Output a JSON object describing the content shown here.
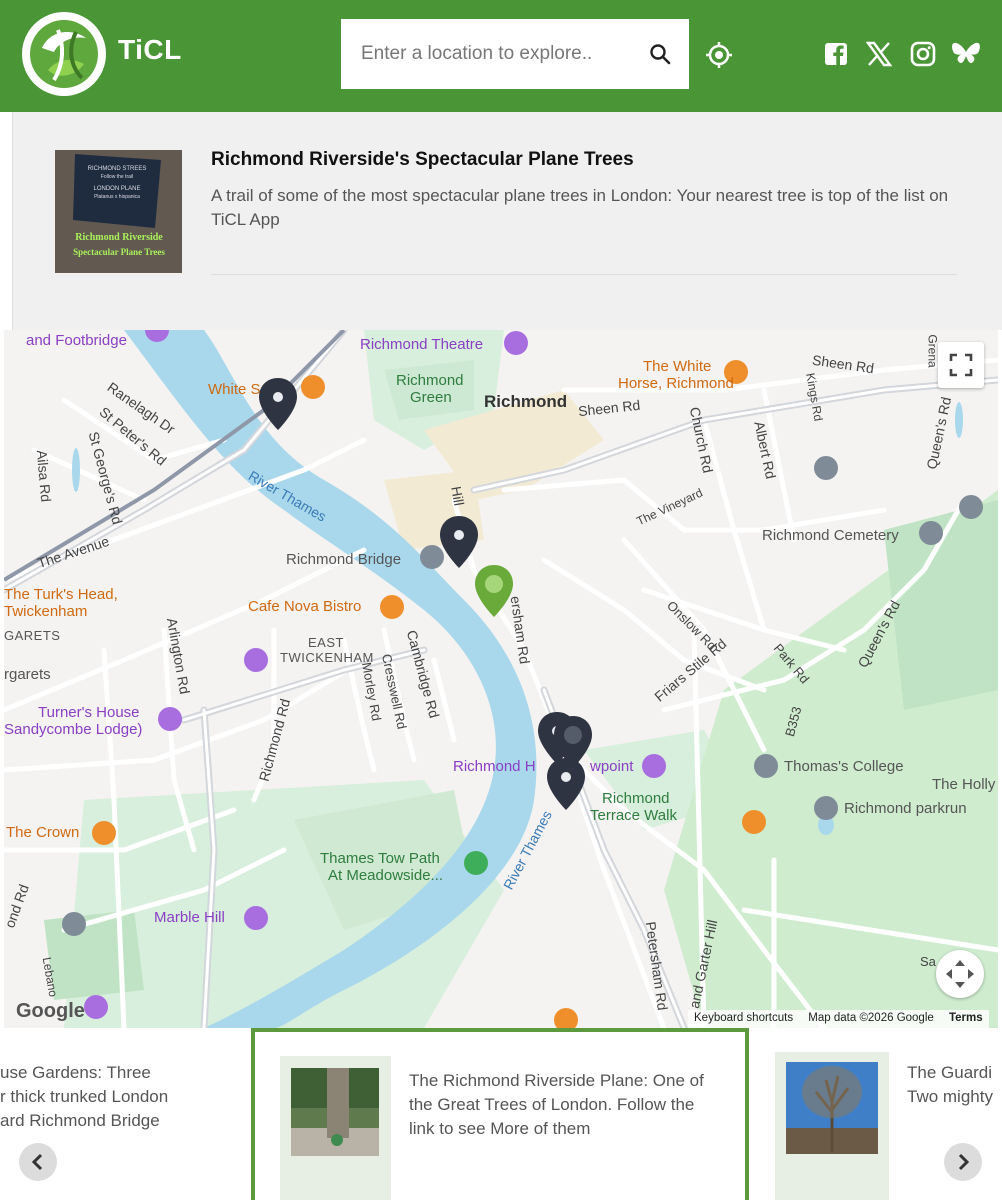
{
  "header": {
    "brand": "TiCL",
    "search_placeholder": "Enter a location to explore..",
    "icons": [
      "ticl-logo-icon",
      "search-icon",
      "locate-icon",
      "facebook-icon",
      "x-icon",
      "instagram-icon",
      "bluesky-icon"
    ],
    "colors": {
      "header_bg": "#4a9536",
      "accent_green": "#5d9a3e"
    }
  },
  "trail": {
    "title": "Richmond Riverside's Spectacular Plane Trees",
    "description": "A trail of some of the most spectacular plane trees in London: Your nearest tree is top of the list on TiCL App",
    "thumb_sign": {
      "lines": [
        "RICHMOND STREES",
        "Follow the trail",
        "LONDON PLANE",
        "Platanus x hispanica"
      ],
      "overlay": [
        "Richmond Riverside",
        "Spectacular Plane Trees"
      ]
    }
  },
  "map": {
    "labels": {
      "footbridge": "and Footbridge",
      "theatre": "Richmond Theatre",
      "white_horse_1": "The White",
      "white_horse_2": "Horse, Richmond",
      "sheen_rd_top": "Sheen Rd",
      "grena": "Grena",
      "white_s": "White S",
      "ranelagh": "Ranelagh Dr",
      "richmond_green_1": "Richmond",
      "richmond_green_2": "Green",
      "richmond": "Richmond",
      "sheen_rd": "Sheen Rd",
      "kings_rd": "Kings Rd",
      "st_peters": "St Peter's Rd",
      "church_rd": "Church Rd",
      "albert_rd": "Albert Rd",
      "queens_rd_top": "Queen's Rd",
      "ailsa": "Ailsa Rd",
      "st_georges": "St George's Rd",
      "river_thames_1": "River Thames",
      "hill": "Hill",
      "the_vineyard": "The Vineyard",
      "the_avenue": "The Avenue",
      "richmond_bridge": "Richmond Bridge",
      "richmond_cemetery": "Richmond Cemetery",
      "turks_head_1": "The Turk's Head,",
      "turks_head_2": "Twickenham",
      "cafe_nova": "Cafe Nova Bistro",
      "petersham_rd_top": "ersham Rd",
      "garets": "GARETS",
      "arlington": "Arlington Rd",
      "east_twickenham_1": "EAST",
      "east_twickenham_2": "TWICKENHAM",
      "cambridge": "Cambridge Rd",
      "onslow": "Onslow Rd",
      "queens_rd_mid": "Queen's Rd",
      "rgarets": "rgarets",
      "morley": "Morley Rd",
      "cresswell": "Cresswell Rd",
      "friars_stile": "Friars Stile Rd",
      "park_rd": "Park Rd",
      "turners_1": "Turner's House",
      "turners_2": "Sandycombe Lodge)",
      "richmond_rd": "Richmond Rd",
      "b353": "B353",
      "the_holly": "The Holly",
      "viewpoint": "Richmond H",
      "viewpoint_2": "wpoint",
      "thomas_college": "Thomas's College",
      "terrace_1": "Richmond",
      "terrace_2": "Terrace Walk",
      "parkrun": "Richmond parkrun",
      "the_crown": "The Crown",
      "tow_path_1": "Thames Tow Path",
      "tow_path_2": "At Meadowside...",
      "river_thames_2": "River Thames",
      "richmond_rd_left": "ond Rd",
      "marble_hill": "Marble Hill",
      "petersham_rd": "Petersham Rd",
      "garter_hill": "and Garter Hill",
      "lebanon": "Lebano",
      "sa": "Sa"
    },
    "google": "Google",
    "footer": {
      "shortcuts": "Keyboard shortcuts",
      "map_data": "Map data ©2026 Google",
      "terms": "Terms"
    },
    "icons": [
      "fullscreen-icon",
      "pan-control-icon",
      "map-pin-icon",
      "selected-pin-icon"
    ]
  },
  "carousel": {
    "left_card_lines": [
      "use Gardens: Three",
      "r thick trunked London",
      "ard Richmond Bridge"
    ],
    "active_card": "The Richmond Riverside Plane: One of the Great Trees of London. Follow the link to see More of them",
    "right_card_lines": [
      "The Guardi",
      "Two mighty"
    ],
    "icons": [
      "chevron-left-icon",
      "chevron-right-icon"
    ]
  }
}
